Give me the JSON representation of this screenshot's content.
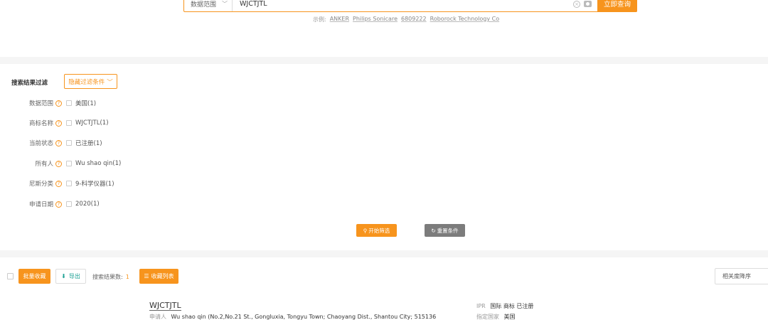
{
  "search": {
    "scope_label": "数据范围",
    "query_value": "WJCTJTL",
    "query_placeholder": "",
    "submit_label": "立即查询",
    "examples_prefix": "示例:",
    "examples": [
      "ANKER",
      "Philips Sonicare",
      "6809222",
      "Roborock Technology Co"
    ]
  },
  "filter": {
    "title": "搜索结果过滤",
    "hide_label": "隐藏过滤条件",
    "rows": [
      {
        "label": "数据范围",
        "option": "美国(1)"
      },
      {
        "label": "商标名称",
        "option": "WJCTJTL(1)"
      },
      {
        "label": "当前状态",
        "option": "已注册(1)"
      },
      {
        "label": "所有人",
        "option": "Wu shao qin(1)"
      },
      {
        "label": "尼斯分类",
        "option": "9-科学仪器(1)"
      },
      {
        "label": "申请日期",
        "option": "2020(1)"
      }
    ],
    "start_label": "开始筛选",
    "reset_label": "重置条件"
  },
  "toolbar": {
    "batch_fav_label": "批量收藏",
    "export_label": "导出",
    "count_label": "搜索结果数:",
    "count_value": "1",
    "fav_list_label": "收藏列表",
    "sort_label": "相关度降序"
  },
  "results": [
    {
      "name": "WJCTJTL",
      "applicant_key": "申请人",
      "applicant_value": "Wu shao qin (No.2,No.21 St., Gongluxia, Tongyu Town; Chaoyang Dist., Shantou City; 515136",
      "ipr_key": "IPR",
      "ipr_value": "国际 商标 已注册",
      "country_key": "指定国家",
      "country_value": "美国"
    }
  ],
  "colors": {
    "accent": "#f7941d",
    "teal": "#1aa093",
    "grey_button": "#7c7c7c"
  }
}
